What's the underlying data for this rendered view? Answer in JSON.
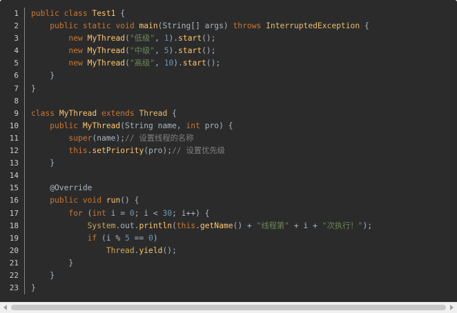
{
  "editor": {
    "lines": [
      {
        "n": "1",
        "t": [
          [
            "public ",
            "kw"
          ],
          [
            "class ",
            "kw"
          ],
          [
            "Test1 ",
            "cls"
          ],
          [
            "{",
            "ident"
          ]
        ]
      },
      {
        "n": "2",
        "t": [
          [
            "    ",
            "ident"
          ],
          [
            "public ",
            "kw"
          ],
          [
            "static ",
            "kw"
          ],
          [
            "void ",
            "kw"
          ],
          [
            "main",
            "fn"
          ],
          [
            "(String[] args) ",
            "ident"
          ],
          [
            "throws ",
            "kw"
          ],
          [
            "InterruptedException ",
            "typ"
          ],
          [
            "{",
            "ident"
          ]
        ]
      },
      {
        "n": "3",
        "t": [
          [
            "        ",
            "ident"
          ],
          [
            "new ",
            "kw"
          ],
          [
            "MyThread",
            "fn"
          ],
          [
            "(",
            "ident"
          ],
          [
            "\"低级\"",
            "cn"
          ],
          [
            ", ",
            "ident"
          ],
          [
            "1",
            "num"
          ],
          [
            ").",
            "ident"
          ],
          [
            "start",
            "fn"
          ],
          [
            "();",
            "ident"
          ]
        ]
      },
      {
        "n": "4",
        "t": [
          [
            "        ",
            "ident"
          ],
          [
            "new ",
            "kw"
          ],
          [
            "MyThread",
            "fn"
          ],
          [
            "(",
            "ident"
          ],
          [
            "\"中级\"",
            "cn"
          ],
          [
            ", ",
            "ident"
          ],
          [
            "5",
            "num"
          ],
          [
            ").",
            "ident"
          ],
          [
            "start",
            "fn"
          ],
          [
            "();",
            "ident"
          ]
        ]
      },
      {
        "n": "5",
        "t": [
          [
            "        ",
            "ident"
          ],
          [
            "new ",
            "kw"
          ],
          [
            "MyThread",
            "fn"
          ],
          [
            "(",
            "ident"
          ],
          [
            "\"高级\"",
            "cn"
          ],
          [
            ", ",
            "ident"
          ],
          [
            "10",
            "num"
          ],
          [
            ").",
            "ident"
          ],
          [
            "start",
            "fn"
          ],
          [
            "();",
            "ident"
          ]
        ]
      },
      {
        "n": "6",
        "t": [
          [
            "    }",
            "ident"
          ]
        ]
      },
      {
        "n": "7",
        "t": [
          [
            "}",
            "ident"
          ]
        ]
      },
      {
        "n": "8",
        "t": []
      },
      {
        "n": "9",
        "t": [
          [
            "class ",
            "kw"
          ],
          [
            "MyThread ",
            "cls"
          ],
          [
            "extends ",
            "kw"
          ],
          [
            "Thread ",
            "typ"
          ],
          [
            "{",
            "ident"
          ]
        ]
      },
      {
        "n": "10",
        "t": [
          [
            "    ",
            "ident"
          ],
          [
            "public ",
            "kw"
          ],
          [
            "MyThread",
            "fn"
          ],
          [
            "(String name, ",
            "ident"
          ],
          [
            "int ",
            "kw"
          ],
          [
            "pro) {",
            "ident"
          ]
        ]
      },
      {
        "n": "11",
        "t": [
          [
            "        ",
            "ident"
          ],
          [
            "super",
            "kw"
          ],
          [
            "(name);",
            "ident"
          ],
          [
            "// 设置线程的名称",
            "cmt"
          ]
        ]
      },
      {
        "n": "12",
        "t": [
          [
            "        ",
            "ident"
          ],
          [
            "this",
            "kw"
          ],
          [
            ".",
            "ident"
          ],
          [
            "setPriority",
            "fn"
          ],
          [
            "(pro);",
            "ident"
          ],
          [
            "// 设置优先级",
            "cmt"
          ]
        ]
      },
      {
        "n": "13",
        "t": [
          [
            "    }",
            "ident"
          ]
        ]
      },
      {
        "n": "14",
        "t": []
      },
      {
        "n": "15",
        "t": [
          [
            "    @Override",
            "ident"
          ]
        ]
      },
      {
        "n": "16",
        "t": [
          [
            "    ",
            "ident"
          ],
          [
            "public ",
            "kw"
          ],
          [
            "void ",
            "kw"
          ],
          [
            "run",
            "fn"
          ],
          [
            "() {",
            "ident"
          ]
        ]
      },
      {
        "n": "17",
        "t": [
          [
            "        ",
            "ident"
          ],
          [
            "for ",
            "kw"
          ],
          [
            "(",
            "ident"
          ],
          [
            "int ",
            "kw"
          ],
          [
            "i = ",
            "ident"
          ],
          [
            "0",
            "num"
          ],
          [
            "; i < ",
            "ident"
          ],
          [
            "30",
            "num"
          ],
          [
            "; i++) {",
            "ident"
          ]
        ]
      },
      {
        "n": "18",
        "t": [
          [
            "            ",
            "ident"
          ],
          [
            "System",
            "fld"
          ],
          [
            ".out.",
            "ident"
          ],
          [
            "println",
            "fn"
          ],
          [
            "(",
            "ident"
          ],
          [
            "this",
            "kw"
          ],
          [
            ".",
            "ident"
          ],
          [
            "getName",
            "fn"
          ],
          [
            "() + ",
            "ident"
          ],
          [
            "\"线程第\"",
            "str"
          ],
          [
            " + i + ",
            "ident"
          ],
          [
            "\"次执行！\"",
            "str"
          ],
          [
            ");",
            "ident"
          ]
        ]
      },
      {
        "n": "19",
        "t": [
          [
            "            ",
            "ident"
          ],
          [
            "if ",
            "kw"
          ],
          [
            "(i % ",
            "ident"
          ],
          [
            "5",
            "num"
          ],
          [
            " == ",
            "ident"
          ],
          [
            "0",
            "num"
          ],
          [
            ")",
            "ident"
          ]
        ]
      },
      {
        "n": "20",
        "t": [
          [
            "                ",
            "ident"
          ],
          [
            "Thread",
            "fld"
          ],
          [
            ".",
            "ident"
          ],
          [
            "yield",
            "fn"
          ],
          [
            "();",
            "ident"
          ]
        ]
      },
      {
        "n": "21",
        "t": [
          [
            "        }",
            "ident"
          ]
        ]
      },
      {
        "n": "22",
        "t": [
          [
            "    }",
            "ident"
          ]
        ]
      },
      {
        "n": "23",
        "t": [
          [
            "}",
            "ident"
          ]
        ]
      }
    ]
  },
  "scrollbar": {
    "left_icon": "arrow-left-icon",
    "right_icon": "arrow-right-icon"
  }
}
